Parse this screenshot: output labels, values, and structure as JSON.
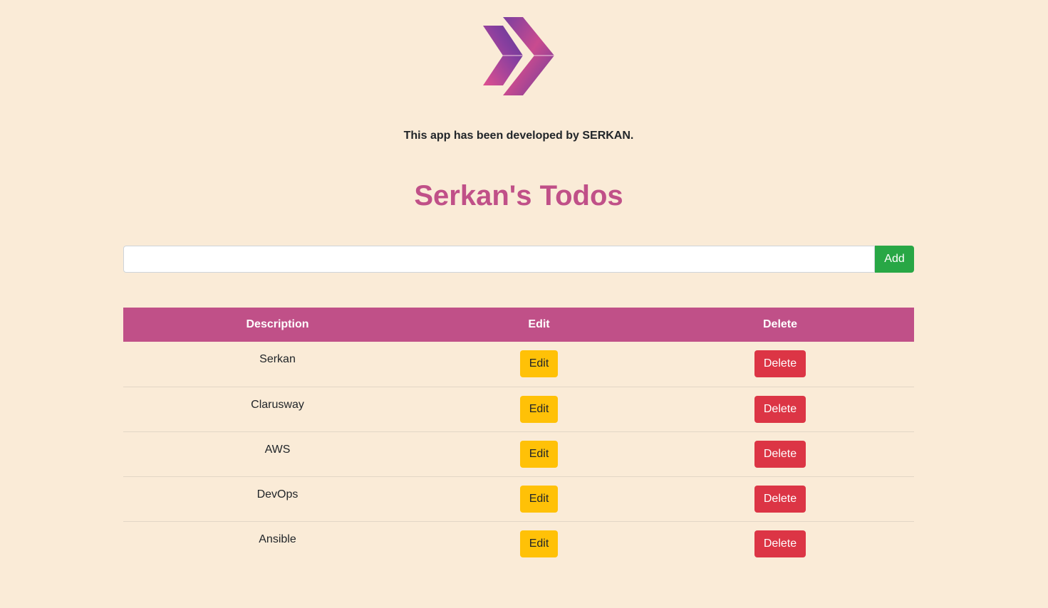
{
  "header": {
    "logo_icon": "chevron-double-right-icon",
    "credit_text": "This app has been developed by SERKAN.",
    "title": "Serkan's Todos"
  },
  "add_form": {
    "input_value": "",
    "input_placeholder": "",
    "add_label": "Add",
    "add_color": "#28a745"
  },
  "table": {
    "header_color": "#c05088",
    "columns": [
      "Description",
      "Edit",
      "Delete"
    ],
    "rows": [
      {
        "description": "Serkan",
        "edit_label": "Edit",
        "delete_label": "Delete"
      },
      {
        "description": "Clarusway",
        "edit_label": "Edit",
        "delete_label": "Delete"
      },
      {
        "description": "AWS",
        "edit_label": "Edit",
        "delete_label": "Delete"
      },
      {
        "description": "DevOps",
        "edit_label": "Edit",
        "delete_label": "Delete"
      },
      {
        "description": "Ansible",
        "edit_label": "Edit",
        "delete_label": "Delete"
      }
    ]
  },
  "colors": {
    "background": "#faebd7",
    "title": "#c05088",
    "edit_button": "#ffc107",
    "delete_button": "#dc3545"
  }
}
